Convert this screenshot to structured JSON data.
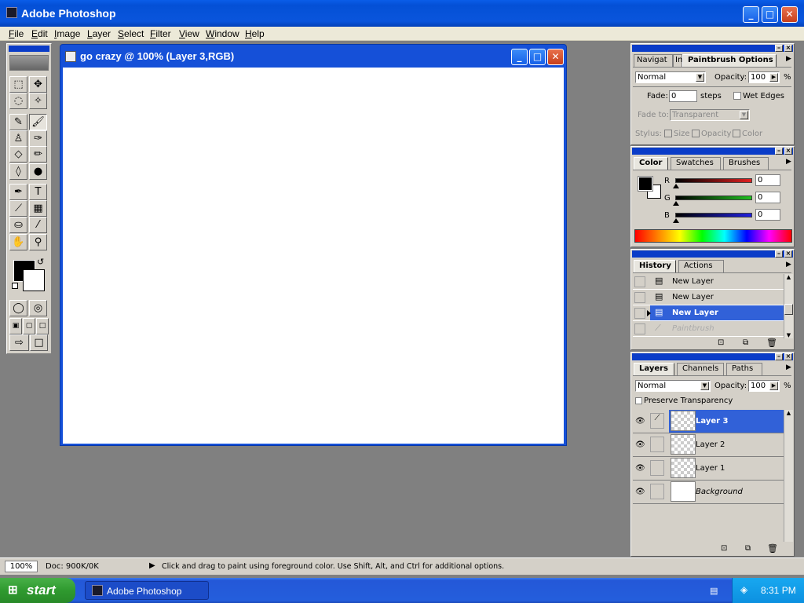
{
  "app": {
    "title": "Adobe Photoshop"
  },
  "menu": [
    "File",
    "Edit",
    "Image",
    "Layer",
    "Select",
    "Filter",
    "View",
    "Window",
    "Help"
  ],
  "document": {
    "title": "go crazy @ 100% (Layer 3,RGB)"
  },
  "tools": [
    {
      "icon": "marquee-icon",
      "glyph": "⬚"
    },
    {
      "icon": "move-icon",
      "glyph": "✥"
    },
    {
      "icon": "lasso-icon",
      "glyph": "◌"
    },
    {
      "icon": "magic-wand-icon",
      "glyph": "✧"
    },
    {
      "icon": "airbrush-icon",
      "glyph": "✎"
    },
    {
      "icon": "paintbrush-icon",
      "glyph": "🖌"
    },
    {
      "icon": "rubber-stamp-icon",
      "glyph": "♙"
    },
    {
      "icon": "history-brush-icon",
      "glyph": "✑"
    },
    {
      "icon": "eraser-icon",
      "glyph": "◇"
    },
    {
      "icon": "pencil-icon",
      "glyph": "✏"
    },
    {
      "icon": "blur-icon",
      "glyph": "◊"
    },
    {
      "icon": "burn-icon",
      "glyph": "●"
    },
    {
      "icon": "pen-icon",
      "glyph": "✒"
    },
    {
      "icon": "type-icon",
      "glyph": "T"
    },
    {
      "icon": "measure-icon",
      "glyph": "⟋"
    },
    {
      "icon": "gradient-icon",
      "glyph": "▦"
    },
    {
      "icon": "paint-bucket-icon",
      "glyph": "⛀"
    },
    {
      "icon": "eyedropper-icon",
      "glyph": "⁄"
    },
    {
      "icon": "hand-icon",
      "glyph": "✋"
    },
    {
      "icon": "zoom-icon",
      "glyph": "⚲"
    }
  ],
  "paintbrush_options": {
    "tabs": [
      "Navigat",
      "In",
      "Paintbrush Options"
    ],
    "mode": "Normal",
    "opacity_label": "Opacity:",
    "opacity": "100",
    "percent": "%",
    "fade_label": "Fade:",
    "fade_value": "0",
    "steps_label": "steps",
    "wet_edges": "Wet Edges",
    "fade_to_label": "Fade to:",
    "fade_to_value": "Transparent",
    "stylus_label": "Stylus:",
    "stylus_size": "Size",
    "stylus_opacity": "Opacity",
    "stylus_color": "Color"
  },
  "color_panel": {
    "tabs": [
      "Color",
      "Swatches",
      "Brushes"
    ],
    "channels": [
      {
        "label": "R",
        "value": "0",
        "color": "#e02020"
      },
      {
        "label": "G",
        "value": "0",
        "color": "#20c020"
      },
      {
        "label": "B",
        "value": "0",
        "color": "#2020e0"
      }
    ]
  },
  "history_panel": {
    "tabs": [
      "History",
      "Actions"
    ],
    "items": [
      {
        "label": "New Layer",
        "state": "normal"
      },
      {
        "label": "New Layer",
        "state": "normal"
      },
      {
        "label": "New Layer",
        "state": "selected"
      },
      {
        "label": "Paintbrush",
        "state": "undone"
      }
    ]
  },
  "layers_panel": {
    "tabs": [
      "Layers",
      "Channels",
      "Paths"
    ],
    "mode": "Normal",
    "opacity_label": "Opacity:",
    "opacity": "100",
    "percent": "%",
    "preserve": "Preserve Transparency",
    "layers": [
      {
        "name": "Layer 3",
        "selected": true
      },
      {
        "name": "Layer 2",
        "selected": false
      },
      {
        "name": "Layer 1",
        "selected": false
      },
      {
        "name": "Background",
        "selected": false
      }
    ]
  },
  "status": {
    "zoom": "100%",
    "doc": "Doc: 900K/0K",
    "hint": "Click and drag to paint using foreground color.  Use Shift, Alt, and Ctrl for additional options."
  },
  "taskbar": {
    "start": "start",
    "task": "Adobe Photoshop",
    "time": "8:31 PM"
  }
}
